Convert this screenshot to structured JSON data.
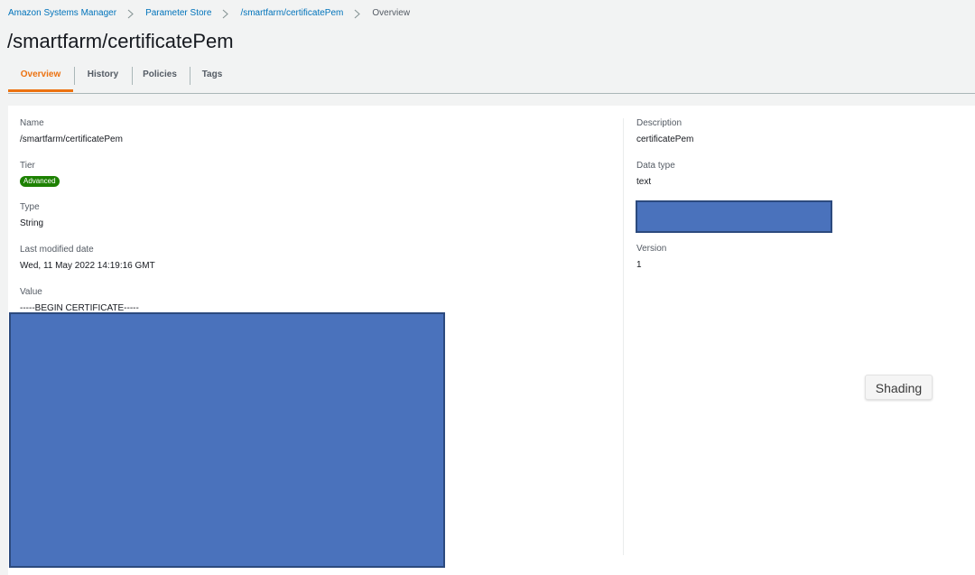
{
  "breadcrumb": {
    "items": [
      {
        "label": "Amazon Systems Manager",
        "link": true
      },
      {
        "label": "Parameter Store",
        "link": true
      },
      {
        "label": "/smartfarm/certificatePem",
        "link": true
      },
      {
        "label": "Overview",
        "link": false
      }
    ],
    "separator_icon": "chevron-right-icon"
  },
  "page": {
    "title": "/smartfarm/certificatePem"
  },
  "tabs": [
    {
      "label": "Overview",
      "active": true
    },
    {
      "label": "History",
      "active": false
    },
    {
      "label": "Policies",
      "active": false
    },
    {
      "label": "Tags",
      "active": false
    }
  ],
  "details": {
    "name_label": "Name",
    "name_value": "/smartfarm/certificatePem",
    "tier_label": "Tier",
    "tier_value": "Advanced",
    "type_label": "Type",
    "type_value": "String",
    "last_modified_label": "Last modified date",
    "last_modified_value": "Wed, 11 May 2022 14:19:16 GMT",
    "value_label": "Value",
    "value_first_line": "-----BEGIN CERTIFICATE-----",
    "description_label": "Description",
    "description_value": "certificatePem",
    "data_type_label": "Data type",
    "data_type_value": "text",
    "version_label": "Version",
    "version_value": "1"
  },
  "tooltip": {
    "text": "Shading"
  },
  "colors": {
    "accent_tab": "#ec7211",
    "link": "#0073bb",
    "badge_green": "#1d8102",
    "redaction_fill": "#4a72bc"
  }
}
